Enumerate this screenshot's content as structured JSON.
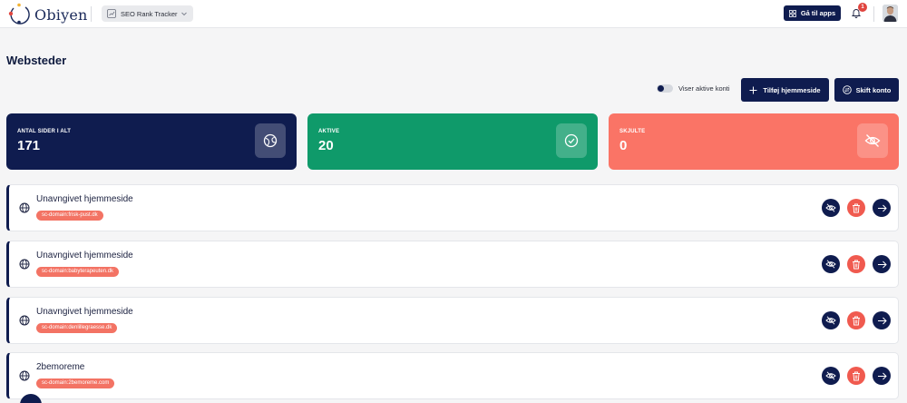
{
  "header": {
    "logo_text": "Obiyen",
    "app_selector": "SEO Rank Tracker",
    "apps_button": "Gå til apps",
    "notification_count": "1"
  },
  "page": {
    "title": "Websteder",
    "toggle_label": "Viser aktive konti",
    "add_button": "Tilføj hjemmeside",
    "switch_button": "Skift konto"
  },
  "stats": [
    {
      "label": "ANTAL SIDER I ALT",
      "value": "171",
      "icon": "globe-icon",
      "color": "#0f1c4f"
    },
    {
      "label": "AKTIVE",
      "value": "20",
      "icon": "check-circle-icon",
      "color": "#0f9a6a"
    },
    {
      "label": "SKJULTE",
      "value": "0",
      "icon": "eye-off-icon",
      "color": "#fa7466"
    }
  ],
  "sites": [
    {
      "name": "Unavngivet hjemmeside",
      "domain": "sc-domain:frisk-pust.dk"
    },
    {
      "name": "Unavngivet hjemmeside",
      "domain": "sc-domain:babyterapeuten.dk"
    },
    {
      "name": "Unavngivet hjemmeside",
      "domain": "sc-domain:denlillegraesse.dk"
    },
    {
      "name": "2bemoreme",
      "domain": "sc-domain:2bemoreme.com"
    }
  ],
  "colors": {
    "navy": "#0f1c4f",
    "green": "#0f9a6a",
    "coral": "#fa7466",
    "delete_red": "#f05a4f"
  }
}
